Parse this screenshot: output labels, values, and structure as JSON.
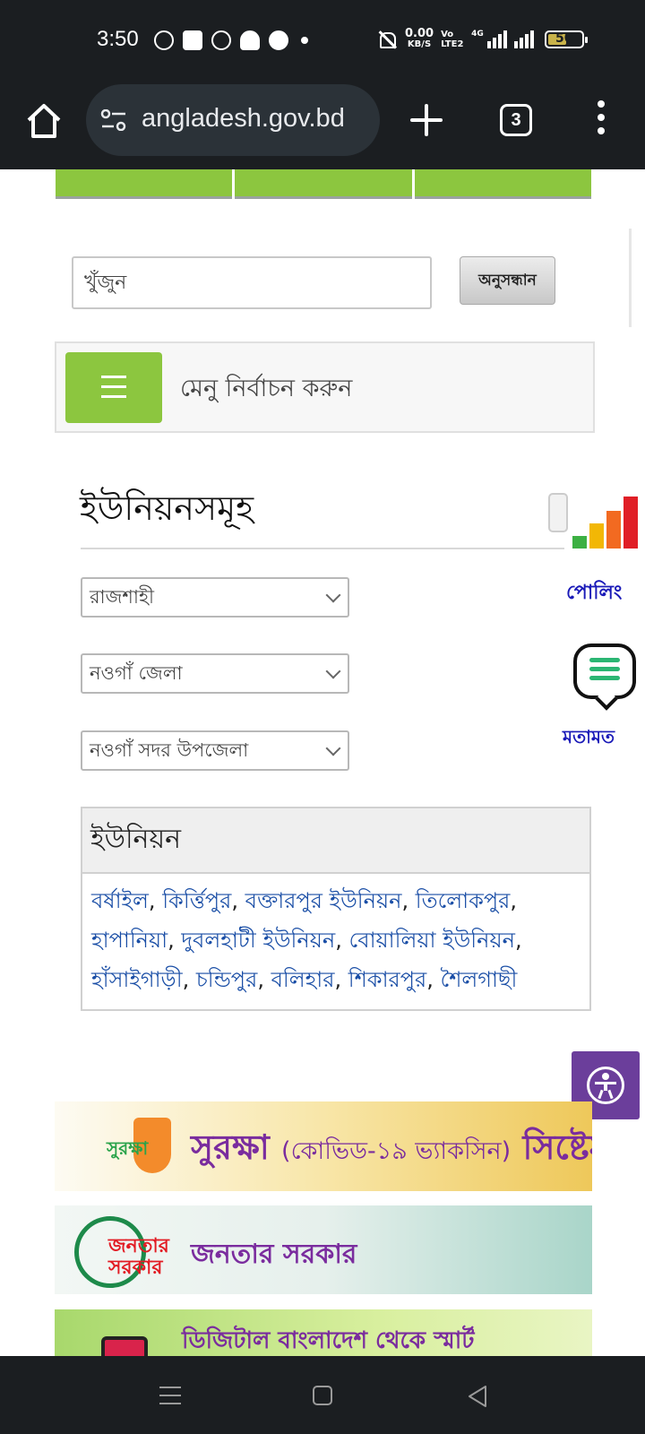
{
  "status_bar": {
    "time": "3:50",
    "net_speed": "0.00",
    "net_unit": "KB/S",
    "volte": "Vo LTE2",
    "network": "4G",
    "battery": "50"
  },
  "browser": {
    "url": "angladesh.gov.bd",
    "tab_count": "3"
  },
  "search": {
    "placeholder": "খুঁজুন",
    "button_label": "অনুসন্ধান"
  },
  "menu": {
    "label": "মেনু নির্বাচন করুন"
  },
  "section": {
    "title": "ইউনিয়নসমূহ"
  },
  "selects": {
    "division": "রাজশাহী",
    "district": "নওগাঁ জেলা",
    "upazila": "নওগাঁ সদর উপজেলা"
  },
  "unions": {
    "header": "ইউনিয়ন",
    "items": [
      "বর্ষাইল",
      "কির্ত্তিপুর",
      "বক্তারপুর ইউনিয়ন",
      "তিলোকপুর",
      "হাপানিয়া",
      "দুবলহাটী ইউনিয়ন",
      "বোয়ালিয়া ইউনিয়ন",
      "হাঁসাইগাড়ী",
      "চন্ডিপুর",
      "বলিহার",
      "শিকারপুর",
      "শৈলগাছী"
    ]
  },
  "side_widgets": {
    "poll_label": "পোলিং",
    "feedback_label": "মতামত",
    "poll_colors": [
      "#3cb043",
      "#f2b705",
      "#f26a21",
      "#e01e26"
    ]
  },
  "banners": {
    "surokkha_logo": "সুরক্ষা",
    "surokkha_title": "সুরক্ষা",
    "surokkha_subtitle": "(কোভিড-১৯ ভ্যাকসিন)",
    "surokkha_suffix": "সিষ্টেম",
    "janatar_logo": "জনতার সরকার",
    "janatar_title": "জনতার সরকার",
    "digital_text": "ডিজিটাল বাংলাদেশ থেকে স্মার্ট"
  }
}
